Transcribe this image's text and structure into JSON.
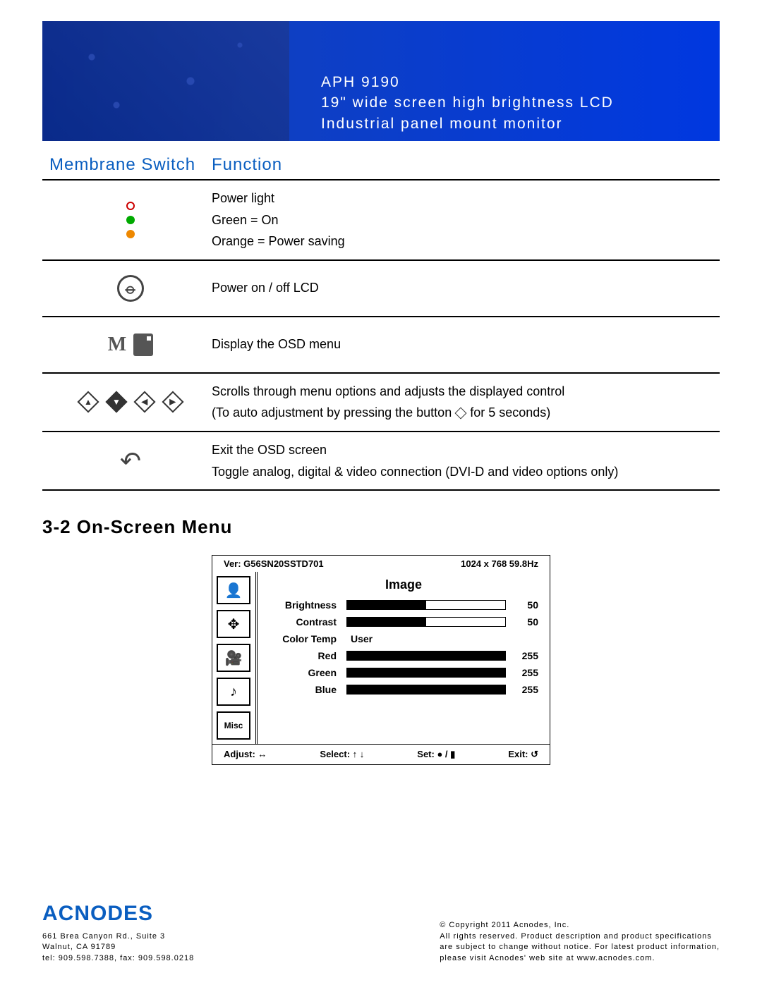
{
  "banner": {
    "model": "APH 9190",
    "line2": "19\" wide screen high brightness LCD",
    "line3": "Industrial panel mount monitor"
  },
  "table": {
    "header_switch": "Membrane Switch",
    "header_function": "Function",
    "rows": [
      {
        "func_lines": [
          "Power light",
          "Green = On",
          "Orange = Power saving"
        ]
      },
      {
        "func_lines": [
          "Power on / off LCD"
        ]
      },
      {
        "func_lines": [
          "Display the OSD menu"
        ]
      },
      {
        "func_lines": [
          "Scrolls through menu options and adjusts the displayed control",
          "(To auto adjustment by pressing the button ◇ for 5 seconds)"
        ]
      },
      {
        "func_lines": [
          "Exit the OSD screen",
          "Toggle analog, digital & video connection (DVI-D and video options only)"
        ]
      }
    ]
  },
  "section": {
    "title": "3-2  On-Screen Menu"
  },
  "osd": {
    "version": "Ver: G56SN20SSTD701",
    "resolution": "1024 x 768  59.8Hz",
    "title": "Image",
    "side_icons": [
      "👤",
      "✥",
      "🎥",
      "♪",
      "Misc"
    ],
    "items": [
      {
        "label": "Brightness",
        "value": 50,
        "max": 100,
        "bar": true
      },
      {
        "label": "Contrast",
        "value": 50,
        "max": 100,
        "bar": true
      },
      {
        "label": "Color Temp",
        "text": "User",
        "bar": false
      },
      {
        "label": "Red",
        "value": 255,
        "max": 255,
        "bar": true
      },
      {
        "label": "Green",
        "value": 255,
        "max": 255,
        "bar": true
      },
      {
        "label": "Blue",
        "value": 255,
        "max": 255,
        "bar": true
      }
    ],
    "bottom": {
      "adjust": "Adjust: ↔",
      "select": "Select: ↑ ↓",
      "set": "Set: ● / ▮",
      "exit": "Exit: ↺"
    }
  },
  "footer": {
    "logo": "ACNODES",
    "addr1": "661 Brea Canyon Rd., Suite 3",
    "addr2": "Walnut, CA 91789",
    "tel": "tel: 909.598.7388, fax: 909.598.0218",
    "copy": "© Copyright 2011 Acnodes, Inc.",
    "line2": "All rights reserved. Product description and product specifications",
    "line3": "are subject to change without notice. For latest product information,",
    "line4": "please visit Acnodes' web site at www.acnodes.com."
  }
}
